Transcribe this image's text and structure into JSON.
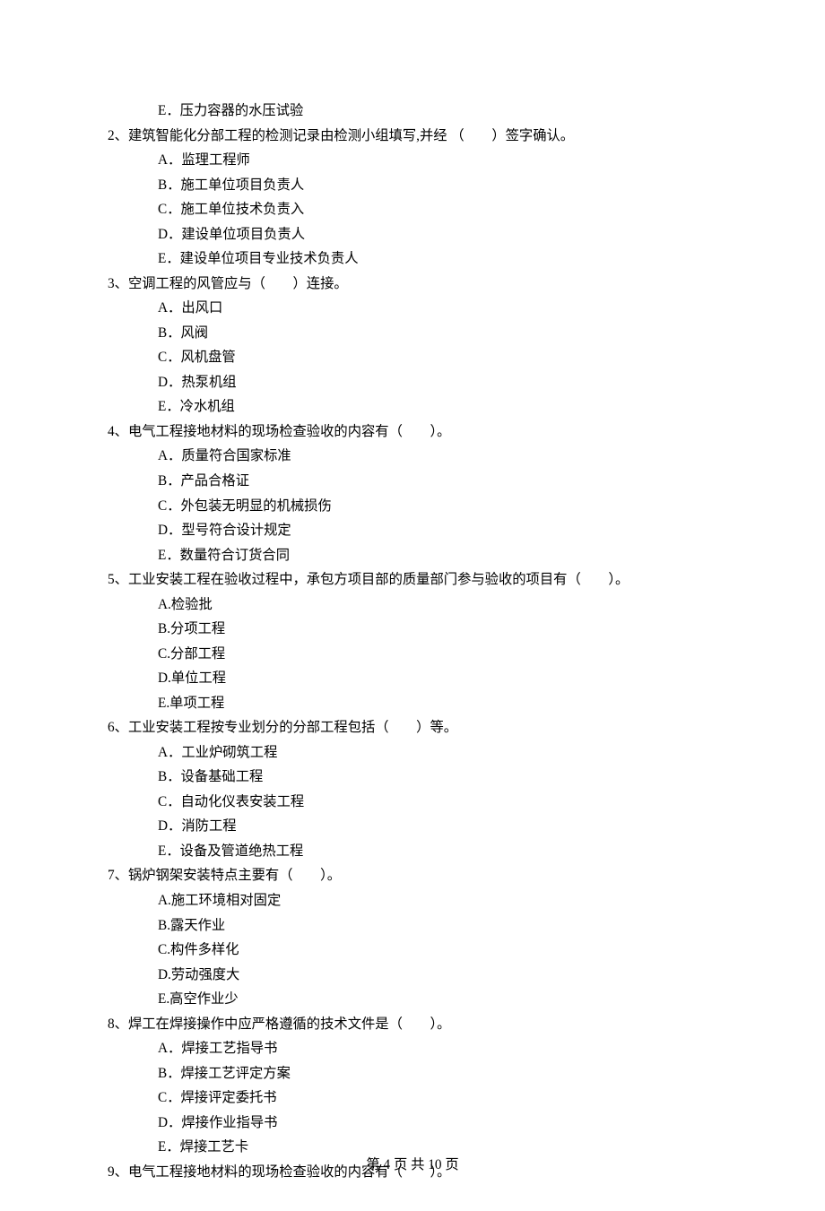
{
  "q1": {
    "opt_e": "E．压力容器的水压试验"
  },
  "q2": {
    "stem": "2、建筑智能化分部工程的检测记录由检测小组填写,并经 （　　）签字确认。",
    "opt_a": "A．监理工程师",
    "opt_b": "B．施工单位项目负责人",
    "opt_c": "C．施工单位技术负责入",
    "opt_d": "D．建设单位项目负责人",
    "opt_e": "E．建设单位项目专业技术负责人"
  },
  "q3": {
    "stem": "3、空调工程的风管应与（　　）连接。",
    "opt_a": "A．出风口",
    "opt_b": "B．风阀",
    "opt_c": "C．风机盘管",
    "opt_d": "D．热泵机组",
    "opt_e": "E．冷水机组"
  },
  "q4": {
    "stem": "4、电气工程接地材料的现场检查验收的内容有（　　）。",
    "opt_a": "A．质量符合国家标准",
    "opt_b": "B．产品合格证",
    "opt_c": "C．外包装无明显的机械损伤",
    "opt_d": "D．型号符合设计规定",
    "opt_e": "E．数量符合订货合同"
  },
  "q5": {
    "stem": "5、工业安装工程在验收过程中，承包方项目部的质量部门参与验收的项目有（　　）。",
    "opt_a": "A.检验批",
    "opt_b": "B.分项工程",
    "opt_c": "C.分部工程",
    "opt_d": "D.单位工程",
    "opt_e": "E.单项工程"
  },
  "q6": {
    "stem": "6、工业安装工程按专业划分的分部工程包括（　　）等。",
    "opt_a": "A．工业炉砌筑工程",
    "opt_b": "B．设备基础工程",
    "opt_c": "C．自动化仪表安装工程",
    "opt_d": "D．消防工程",
    "opt_e": "E．设备及管道绝热工程"
  },
  "q7": {
    "stem": "7、锅炉钢架安装特点主要有（　　）。",
    "opt_a": "A.施工环境相对固定",
    "opt_b": "B.露天作业",
    "opt_c": "C.构件多样化",
    "opt_d": "D.劳动强度大",
    "opt_e": "E.高空作业少"
  },
  "q8": {
    "stem": "8、焊工在焊接操作中应严格遵循的技术文件是（　　）。",
    "opt_a": "A．焊接工艺指导书",
    "opt_b": "B．焊接工艺评定方案",
    "opt_c": "C．焊接评定委托书",
    "opt_d": "D．焊接作业指导书",
    "opt_e": "E．焊接工艺卡"
  },
  "q9": {
    "stem": "9、电气工程接地材料的现场检查验收的内容有（　　）。"
  },
  "footer": "第 4 页 共 10 页"
}
